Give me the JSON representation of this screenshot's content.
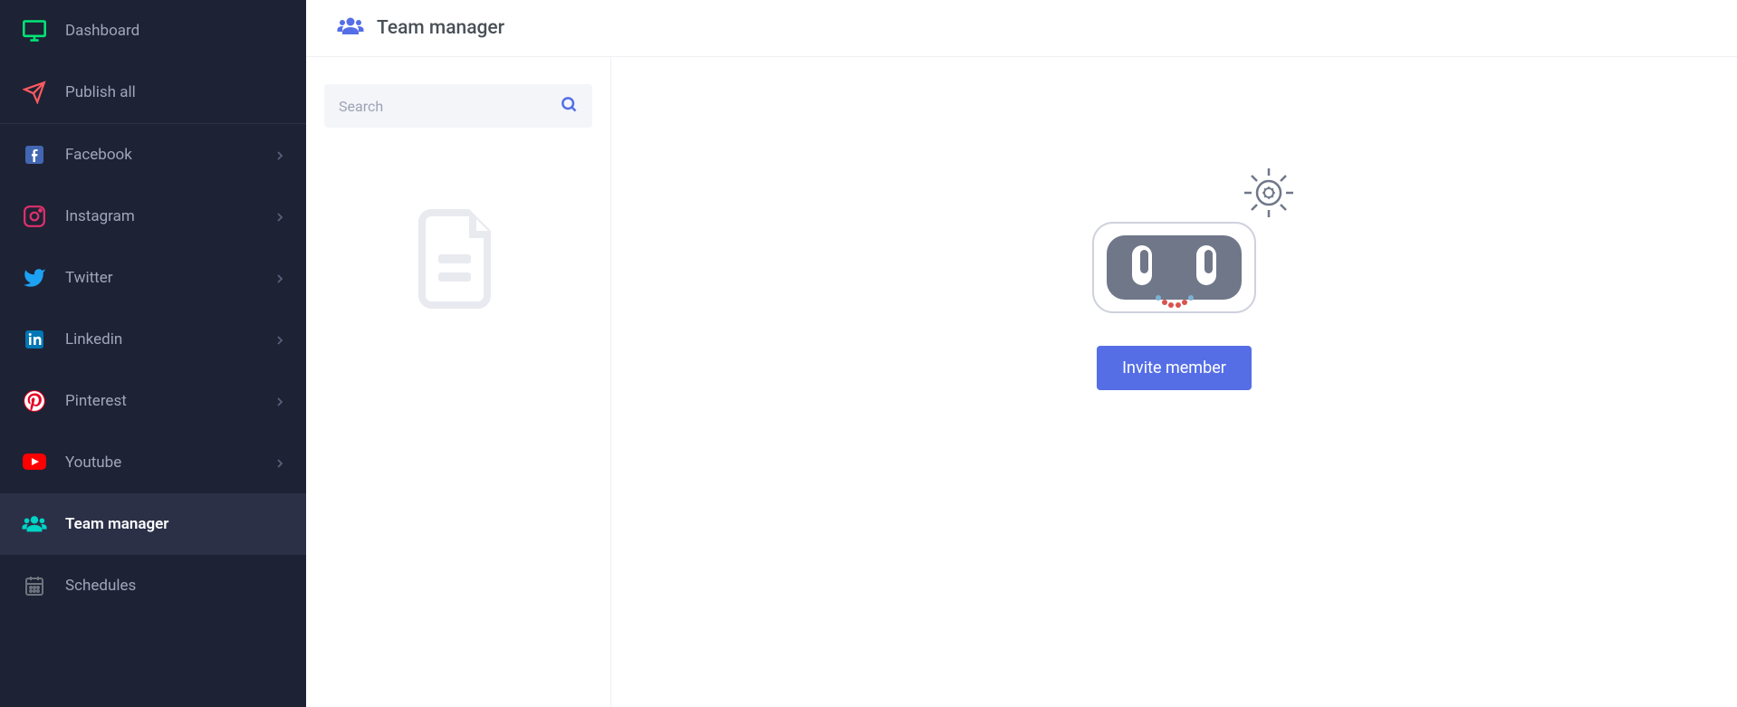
{
  "sidebar": {
    "items": [
      {
        "label": "Dashboard",
        "icon": "monitor",
        "color": "#00e676"
      },
      {
        "label": "Publish all",
        "icon": "send",
        "color": "#ff5a5f"
      },
      {
        "label": "Facebook",
        "icon": "facebook",
        "color": "#4267b2",
        "expandable": true
      },
      {
        "label": "Instagram",
        "icon": "instagram",
        "color": "#e1306c",
        "expandable": true
      },
      {
        "label": "Twitter",
        "icon": "twitter",
        "color": "#1da1f2",
        "expandable": true
      },
      {
        "label": "Linkedin",
        "icon": "linkedin",
        "color": "#0077b5",
        "expandable": true
      },
      {
        "label": "Pinterest",
        "icon": "pinterest",
        "color": "#e60023",
        "expandable": true
      },
      {
        "label": "Youtube",
        "icon": "youtube",
        "color": "#ff0000",
        "expandable": true
      },
      {
        "label": "Team manager",
        "icon": "users",
        "color": "#00d4c5",
        "active": true
      },
      {
        "label": "Schedules",
        "icon": "calendar",
        "color": "#6c757d"
      }
    ]
  },
  "header": {
    "title": "Team manager"
  },
  "search": {
    "placeholder": "Search"
  },
  "invite": {
    "label": "Invite member"
  }
}
